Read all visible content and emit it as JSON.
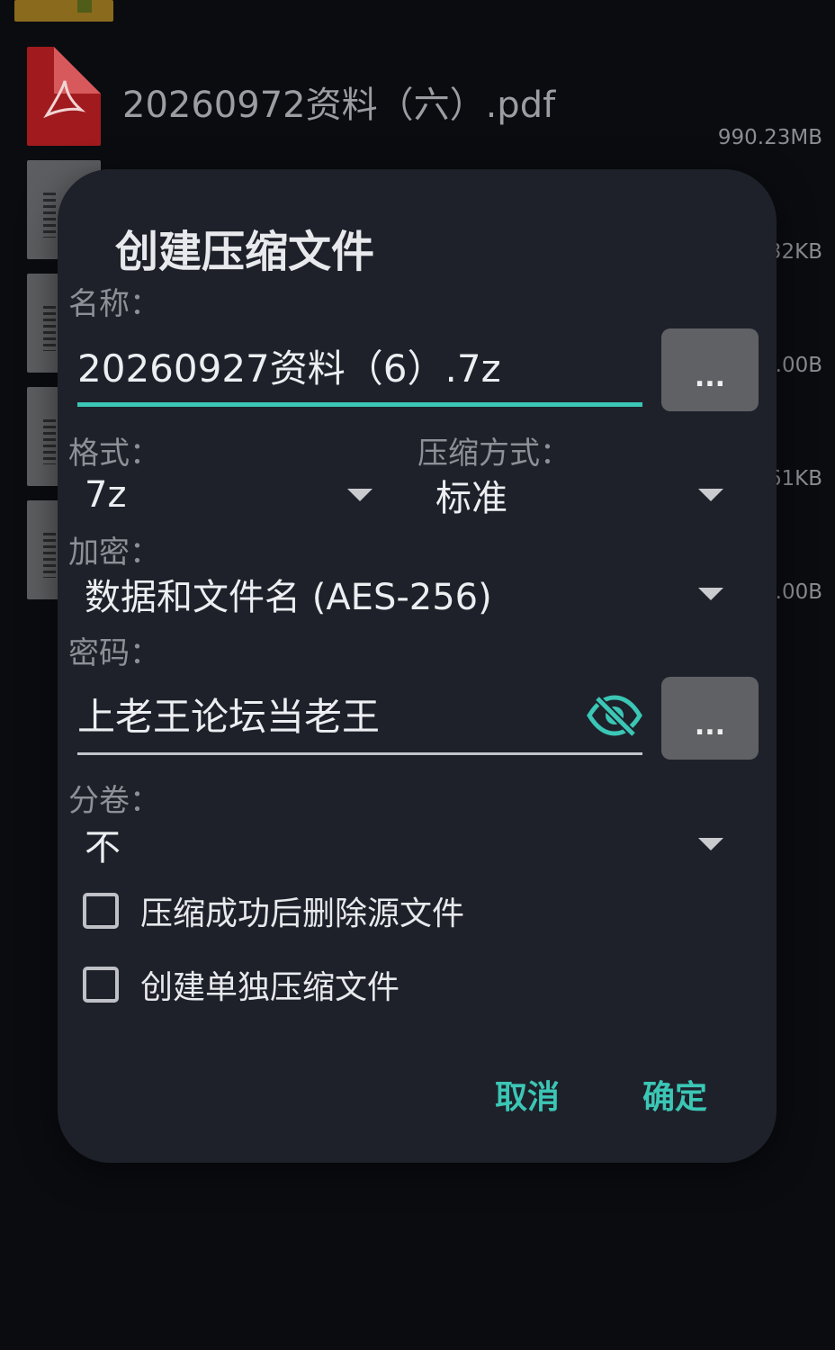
{
  "background": {
    "pdf_file_name": "20260972资料（六）.pdf",
    "sizes": [
      "990.23MB",
      "32KB",
      ".00B",
      "61KB",
      ".00B"
    ]
  },
  "dialog": {
    "title": "创建压缩文件",
    "name_label": "名称：",
    "name_value": "20260927资料（6）.7z",
    "browse_label": "...",
    "format_label": "格式：",
    "format_value": "7z",
    "method_label": "压缩方式：",
    "method_value": "标准",
    "encryption_label": "加密：",
    "encryption_value": "数据和文件名 (AES-256)",
    "password_label": "密码：",
    "password_value": "上老王论坛当老王",
    "password_button_label": "...",
    "split_label": "分卷：",
    "split_value": "不",
    "delete_source_label": "压缩成功后删除源文件",
    "separate_archives_label": "创建单独压缩文件",
    "cancel_label": "取消",
    "confirm_label": "确定"
  },
  "colors": {
    "accent": "#3bc6b5",
    "dialog_bg": "#1e212a",
    "screen_bg": "#0b0c10"
  }
}
